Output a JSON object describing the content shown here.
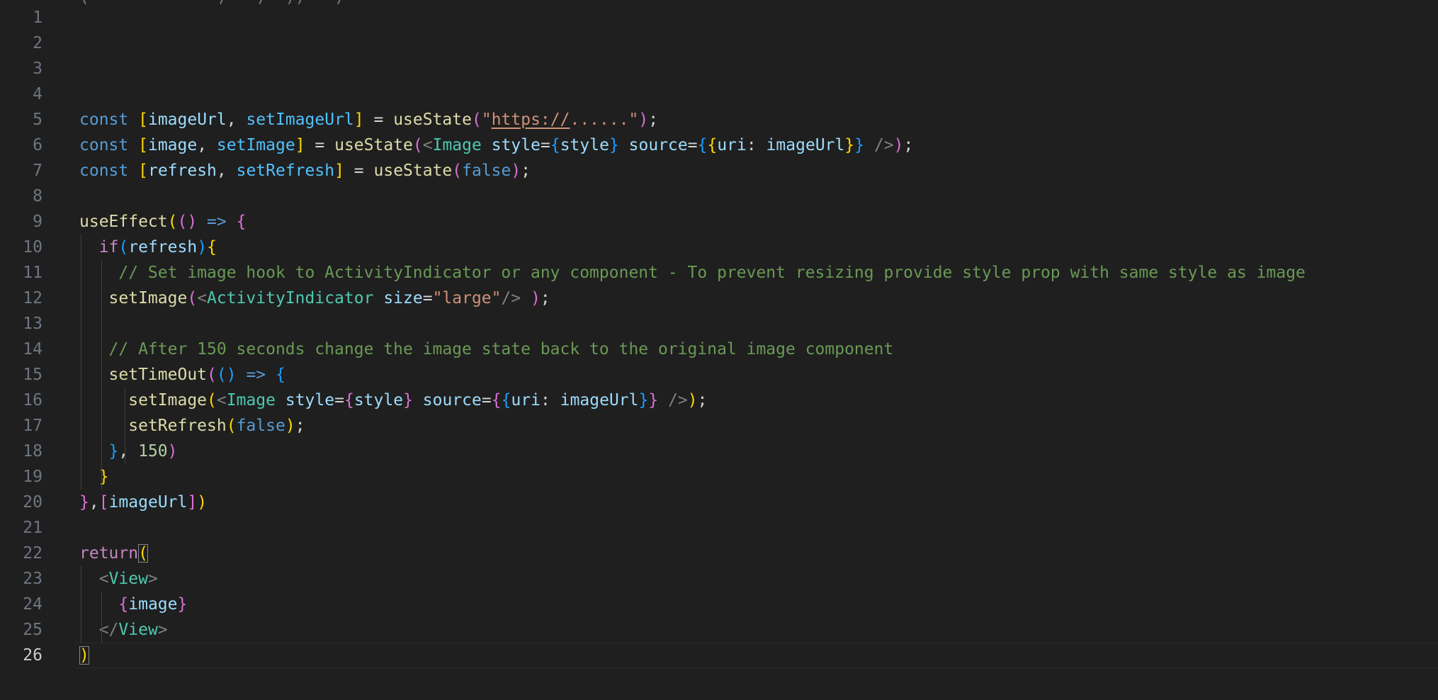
{
  "editor": {
    "top_fragment": "(             )   )  ))   )",
    "line_numbers": [
      "1",
      "2",
      "3",
      "4",
      "5",
      "6",
      "7",
      "8",
      "9",
      "10",
      "11",
      "12",
      "13",
      "14",
      "15",
      "16",
      "17",
      "18",
      "19",
      "20",
      "21",
      "22",
      "23",
      "24",
      "25",
      "26"
    ],
    "active_line_number": "26",
    "lines": [
      [],
      [],
      [],
      [],
      [
        [
          "kw",
          "const"
        ],
        [
          "plain",
          " "
        ],
        [
          "b1",
          "["
        ],
        [
          "var",
          "imageUrl"
        ],
        [
          "plain",
          ", "
        ],
        [
          "const",
          "setImageUrl"
        ],
        [
          "b1",
          "]"
        ],
        [
          "plain",
          " = "
        ],
        [
          "fn",
          "useState"
        ],
        [
          "b2",
          "("
        ],
        [
          "str",
          "\""
        ],
        [
          "link",
          "https://"
        ],
        [
          "str",
          "......\""
        ],
        [
          "b2",
          ")"
        ],
        [
          "plain",
          ";"
        ]
      ],
      [
        [
          "kw",
          "const"
        ],
        [
          "plain",
          " "
        ],
        [
          "b1",
          "["
        ],
        [
          "var",
          "image"
        ],
        [
          "plain",
          ", "
        ],
        [
          "const",
          "setImage"
        ],
        [
          "b1",
          "]"
        ],
        [
          "plain",
          " = "
        ],
        [
          "fn",
          "useState"
        ],
        [
          "b2",
          "("
        ],
        [
          "punct",
          "<"
        ],
        [
          "tag",
          "Image"
        ],
        [
          "plain",
          " "
        ],
        [
          "attr",
          "style"
        ],
        [
          "plain",
          "="
        ],
        [
          "b3",
          "{"
        ],
        [
          "var",
          "style"
        ],
        [
          "b3",
          "}"
        ],
        [
          "plain",
          " "
        ],
        [
          "attr",
          "source"
        ],
        [
          "plain",
          "="
        ],
        [
          "b3",
          "{"
        ],
        [
          "b1",
          "{"
        ],
        [
          "var",
          "uri"
        ],
        [
          "plain",
          ": "
        ],
        [
          "var",
          "imageUrl"
        ],
        [
          "b1",
          "}"
        ],
        [
          "b3",
          "}"
        ],
        [
          "plain",
          " "
        ],
        [
          "punct",
          "/>"
        ],
        [
          "b2",
          ")"
        ],
        [
          "plain",
          ";"
        ]
      ],
      [
        [
          "kw",
          "const"
        ],
        [
          "plain",
          " "
        ],
        [
          "b1",
          "["
        ],
        [
          "var",
          "refresh"
        ],
        [
          "plain",
          ", "
        ],
        [
          "const",
          "setRefresh"
        ],
        [
          "b1",
          "]"
        ],
        [
          "plain",
          " = "
        ],
        [
          "fn",
          "useState"
        ],
        [
          "b2",
          "("
        ],
        [
          "kw",
          "false"
        ],
        [
          "b2",
          ")"
        ],
        [
          "plain",
          ";"
        ]
      ],
      [],
      [
        [
          "fn",
          "useEffect"
        ],
        [
          "b1",
          "("
        ],
        [
          "b2",
          "()"
        ],
        [
          "plain",
          " "
        ],
        [
          "kw",
          "=>"
        ],
        [
          "plain",
          " "
        ],
        [
          "b2",
          "{"
        ]
      ],
      [
        [
          "plain",
          "  "
        ],
        [
          "ctl",
          "if"
        ],
        [
          "b3",
          "("
        ],
        [
          "var",
          "refresh"
        ],
        [
          "b3",
          ")"
        ],
        [
          "b1",
          "{"
        ]
      ],
      [
        [
          "plain",
          "    "
        ],
        [
          "cmt",
          "// Set image hook to ActivityIndicator or any component - To prevent resizing provide style prop with same style as image"
        ]
      ],
      [
        [
          "plain",
          "   "
        ],
        [
          "fn",
          "setImage"
        ],
        [
          "b2",
          "("
        ],
        [
          "punct",
          "<"
        ],
        [
          "tag",
          "ActivityIndicator"
        ],
        [
          "plain",
          " "
        ],
        [
          "attr",
          "size"
        ],
        [
          "plain",
          "="
        ],
        [
          "str",
          "\"large\""
        ],
        [
          "punct",
          "/>"
        ],
        [
          "plain",
          " "
        ],
        [
          "b2",
          ")"
        ],
        [
          "plain",
          ";"
        ]
      ],
      [],
      [
        [
          "plain",
          "   "
        ],
        [
          "cmt",
          "// After 150 seconds change the image state back to the original image component"
        ]
      ],
      [
        [
          "plain",
          "   "
        ],
        [
          "fn",
          "setTimeOut"
        ],
        [
          "b2",
          "("
        ],
        [
          "b3",
          "()"
        ],
        [
          "plain",
          " "
        ],
        [
          "kw",
          "=>"
        ],
        [
          "plain",
          " "
        ],
        [
          "b3",
          "{"
        ]
      ],
      [
        [
          "plain",
          "     "
        ],
        [
          "fn",
          "setImage"
        ],
        [
          "b1",
          "("
        ],
        [
          "punct",
          "<"
        ],
        [
          "tag",
          "Image"
        ],
        [
          "plain",
          " "
        ],
        [
          "attr",
          "style"
        ],
        [
          "plain",
          "="
        ],
        [
          "b2",
          "{"
        ],
        [
          "var",
          "style"
        ],
        [
          "b2",
          "}"
        ],
        [
          "plain",
          " "
        ],
        [
          "attr",
          "source"
        ],
        [
          "plain",
          "="
        ],
        [
          "b2",
          "{"
        ],
        [
          "b3",
          "{"
        ],
        [
          "var",
          "uri"
        ],
        [
          "plain",
          ": "
        ],
        [
          "var",
          "imageUrl"
        ],
        [
          "b3",
          "}"
        ],
        [
          "b2",
          "}"
        ],
        [
          "plain",
          " "
        ],
        [
          "punct",
          "/>"
        ],
        [
          "b1",
          ")"
        ],
        [
          "plain",
          ";"
        ]
      ],
      [
        [
          "plain",
          "     "
        ],
        [
          "fn",
          "setRefresh"
        ],
        [
          "b1",
          "("
        ],
        [
          "kw",
          "false"
        ],
        [
          "b1",
          ")"
        ],
        [
          "plain",
          ";"
        ]
      ],
      [
        [
          "plain",
          "   "
        ],
        [
          "b3",
          "}"
        ],
        [
          "plain",
          ", "
        ],
        [
          "num",
          "150"
        ],
        [
          "b2",
          ")"
        ]
      ],
      [
        [
          "plain",
          "  "
        ],
        [
          "b1",
          "}"
        ]
      ],
      [
        [
          "b2",
          "}"
        ],
        [
          "plain",
          ","
        ],
        [
          "b2",
          "["
        ],
        [
          "var",
          "imageUrl"
        ],
        [
          "b2",
          "]"
        ],
        [
          "b1",
          ")"
        ]
      ],
      [],
      [
        [
          "ctl",
          "return"
        ],
        [
          "match",
          "("
        ]
      ],
      [
        [
          "plain",
          "  "
        ],
        [
          "punct",
          "<"
        ],
        [
          "tag",
          "View"
        ],
        [
          "punct",
          ">"
        ]
      ],
      [
        [
          "plain",
          "    "
        ],
        [
          "b2",
          "{"
        ],
        [
          "var",
          "image"
        ],
        [
          "b2",
          "}"
        ]
      ],
      [
        [
          "plain",
          "  "
        ],
        [
          "punct",
          "</"
        ],
        [
          "tag",
          "View"
        ],
        [
          "punct",
          ">"
        ]
      ],
      [
        [
          "match",
          ")"
        ]
      ]
    ]
  },
  "colors": {
    "background": "#1f1f1f",
    "line_number": "#6e7681",
    "active_line_number": "#cccccc",
    "keyword": "#569cd6",
    "control": "#c586c0",
    "variable": "#9cdcfe",
    "constant": "#4fc1ff",
    "function": "#dcdcaa",
    "string": "#ce9178",
    "number": "#b5cea8",
    "comment": "#6a9955",
    "tag": "#4ec9b0",
    "bracket_1": "#ffd700",
    "bracket_2": "#da70d6",
    "bracket_3": "#179fff"
  }
}
